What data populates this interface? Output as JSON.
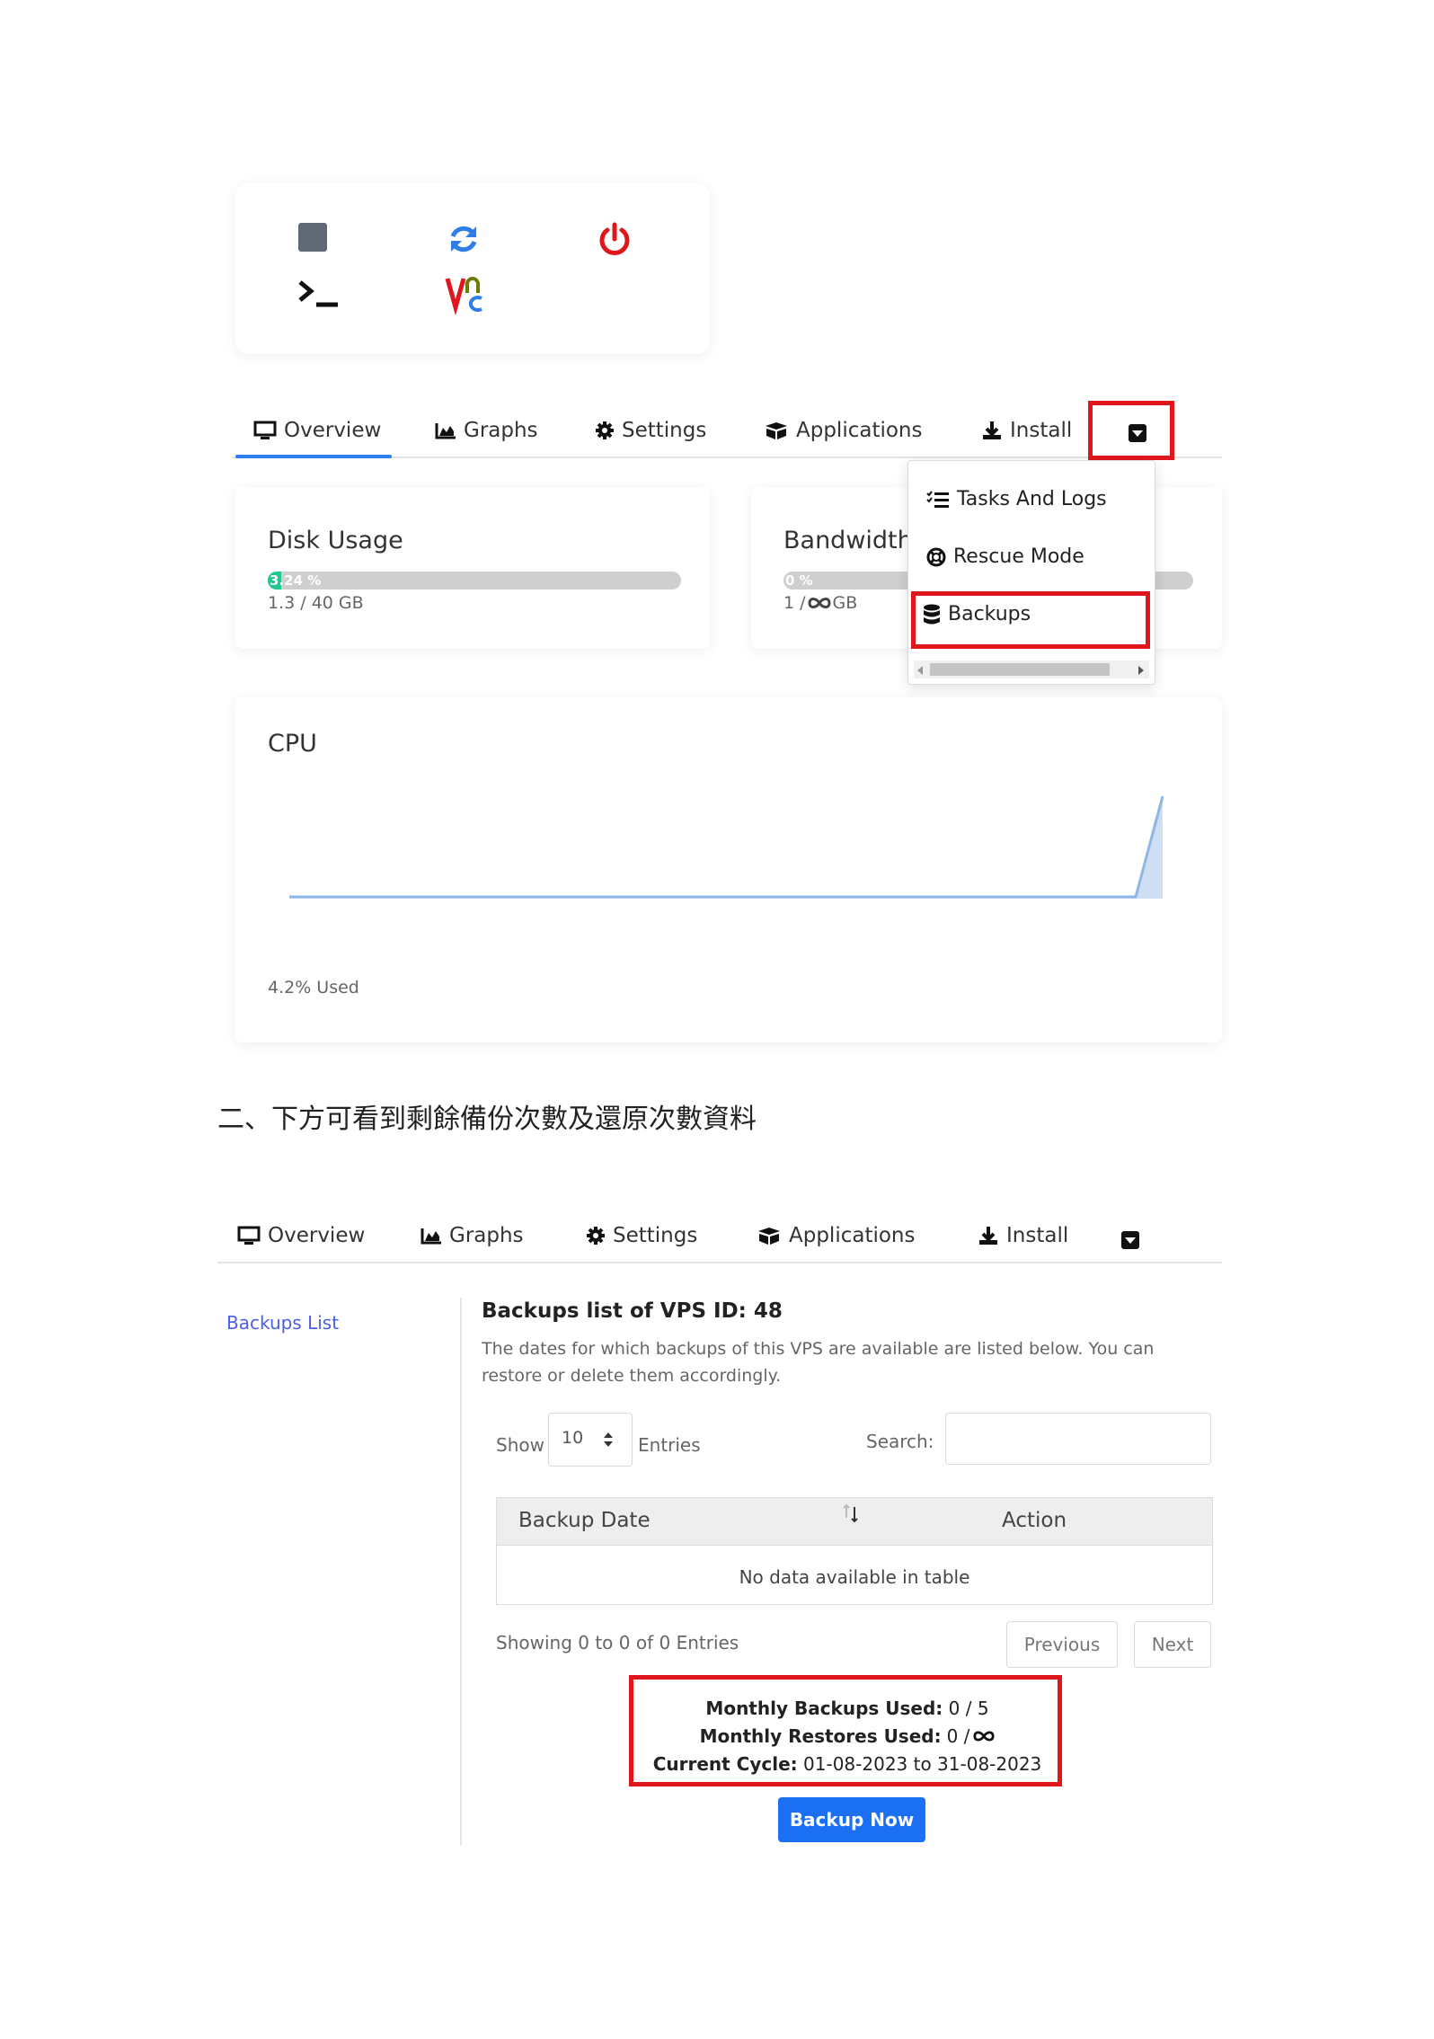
{
  "top": {
    "power_buttons": [
      {
        "name": "stop",
        "icon": "stop-square-icon"
      },
      {
        "name": "restart",
        "icon": "refresh-icon"
      },
      {
        "name": "power",
        "icon": "power-icon"
      },
      {
        "name": "console",
        "icon": "terminal-icon"
      },
      {
        "name": "vnc",
        "icon": "vnc-icon"
      }
    ],
    "vnc_label": "Vnc",
    "tabs": [
      {
        "label": "Overview",
        "icon": "monitor-icon",
        "active": true
      },
      {
        "label": "Graphs",
        "icon": "area-chart-icon"
      },
      {
        "label": "Settings",
        "icon": "gear-icon"
      },
      {
        "label": "Applications",
        "icon": "boxes-icon"
      },
      {
        "label": "Install",
        "icon": "download-icon"
      }
    ],
    "dropdown": {
      "items": [
        {
          "label": "Tasks And Logs",
          "icon": "list-check-icon"
        },
        {
          "label": "Rescue Mode",
          "icon": "lifebuoy-icon"
        },
        {
          "label": "Backups",
          "icon": "database-icon",
          "highlighted": true
        }
      ]
    },
    "disk": {
      "title": "Disk Usage",
      "percent_label": "3.24 %",
      "percent": 3.24,
      "usage": "1.3 / 40 GB"
    },
    "bandwidth": {
      "title": "Bandwidth",
      "percent_label": "0 %",
      "percent": 0,
      "usage_prefix": "1 / ",
      "usage_suffix": " GB"
    },
    "cpu": {
      "title": "CPU",
      "used_label": "4.2% Used"
    }
  },
  "instruction": "二、下方可看到剩餘備份次數及還原次數資料",
  "bottom": {
    "tabs": [
      {
        "label": "Overview",
        "icon": "monitor-icon"
      },
      {
        "label": "Graphs",
        "icon": "area-chart-icon"
      },
      {
        "label": "Settings",
        "icon": "gear-icon"
      },
      {
        "label": "Applications",
        "icon": "boxes-icon"
      },
      {
        "label": "Install",
        "icon": "download-icon"
      }
    ],
    "sidebar_link": "Backups List",
    "heading": "Backups list of VPS ID: 48",
    "description_line1": "The dates for which backups of this VPS are available are listed below. You can",
    "description_line2": "restore or delete them accordingly.",
    "show_label": "Show",
    "entries_value": "10",
    "entries_label": "Entries",
    "search_label": "Search:",
    "search_value": "",
    "columns": [
      "Backup Date",
      "Action"
    ],
    "empty_message": "No data available in table",
    "showing_text": "Showing 0 to 0 of 0 Entries",
    "prev_label": "Previous",
    "next_label": "Next",
    "quota": {
      "backups_label": "Monthly Backups Used:",
      "backups_value": "0 / 5",
      "restores_label": "Monthly Restores Used:",
      "restores_value_prefix": "0 / ",
      "cycle_label": "Current Cycle:",
      "cycle_value": "01-08-2023 to 31-08-2023"
    },
    "backup_now_label": "Backup Now"
  },
  "colors": {
    "accent": "#2f80ed",
    "highlight_red": "#e0161d",
    "progress_green": "#1fc98e",
    "primary_button": "#1a6ff2",
    "link": "#4a5ee8"
  }
}
